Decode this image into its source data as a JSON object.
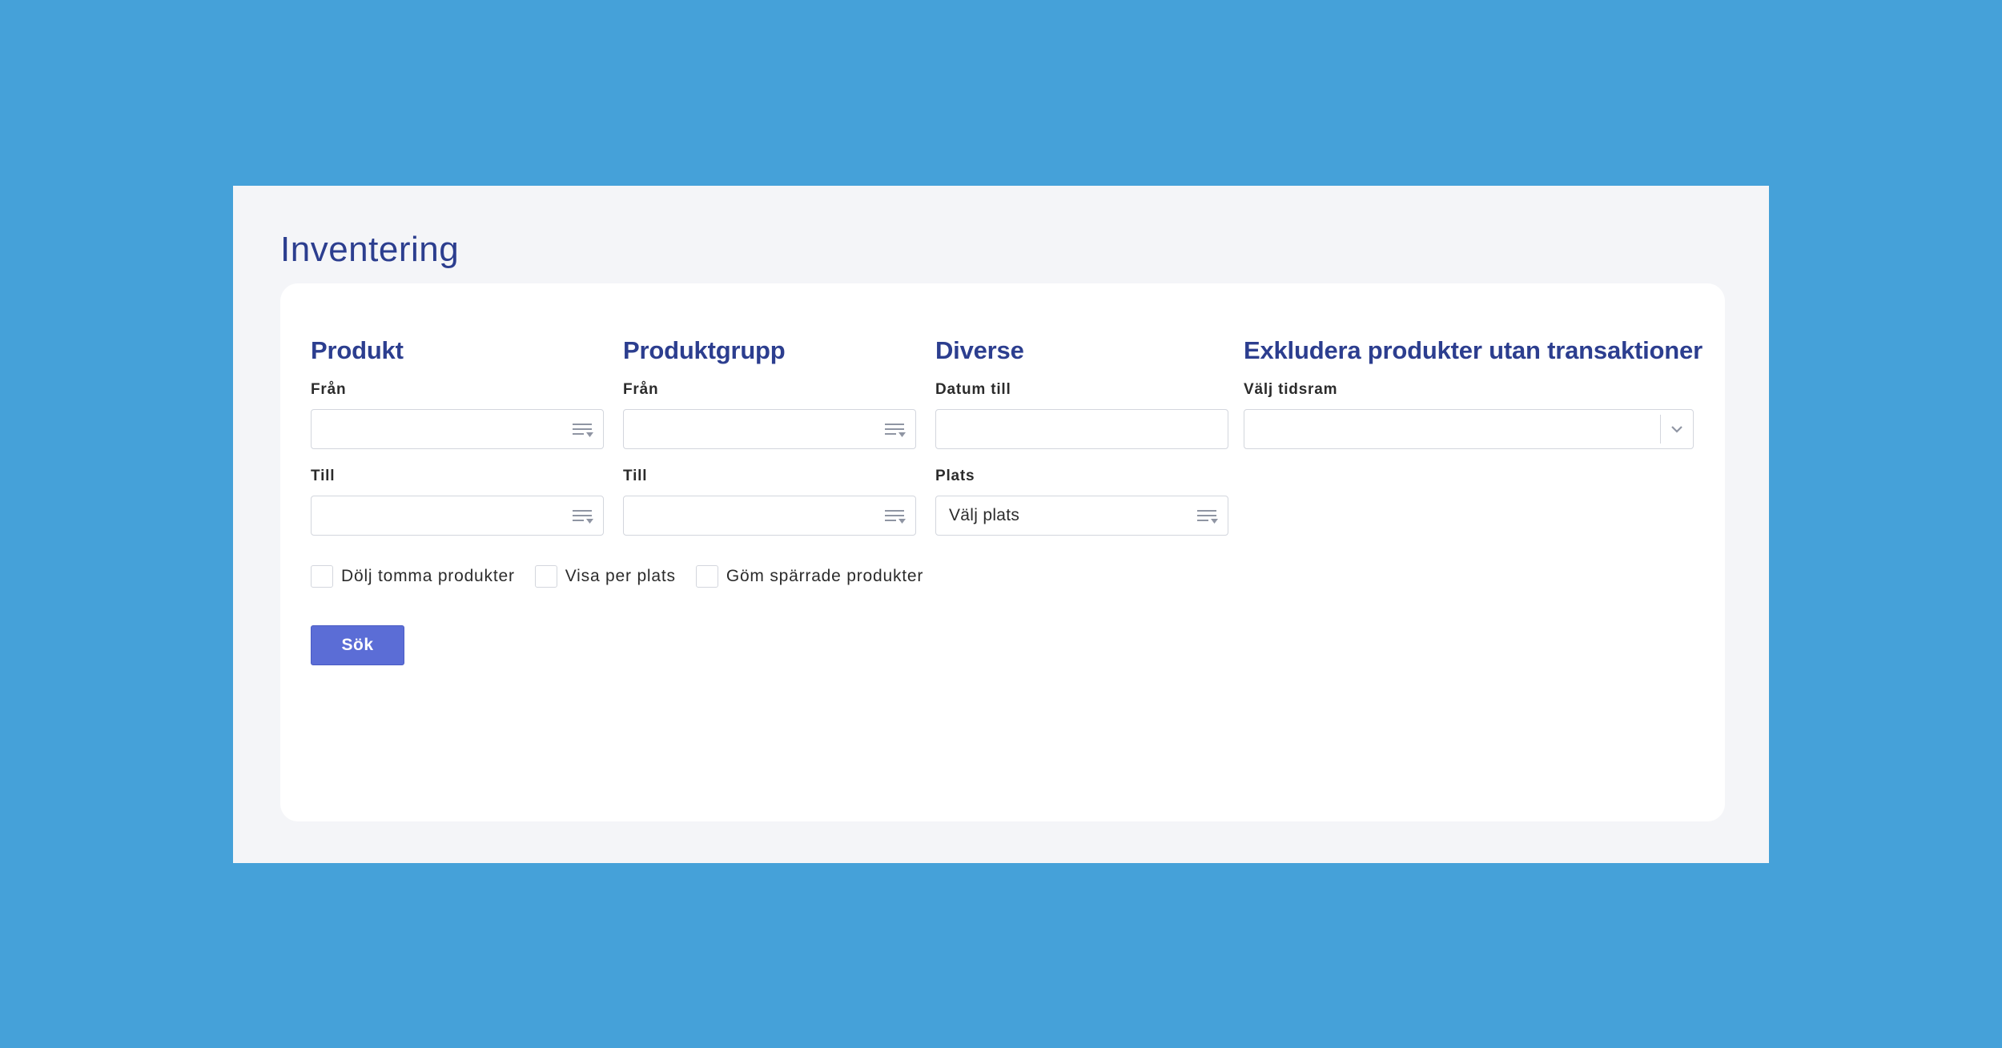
{
  "page": {
    "title": "Inventering"
  },
  "sections": {
    "produkt": {
      "title": "Produkt",
      "from_label": "Från",
      "from_value": "",
      "to_label": "Till",
      "to_value": ""
    },
    "produktgrupp": {
      "title": "Produktgrupp",
      "from_label": "Från",
      "from_value": "",
      "to_label": "Till",
      "to_value": ""
    },
    "diverse": {
      "title": "Diverse",
      "date_label": "Datum till",
      "date_value": "",
      "location_label": "Plats",
      "location_value": "Välj plats"
    },
    "exkludera": {
      "title": "Exkludera produkter utan transaktioner",
      "timeframe_label": "Välj tidsram",
      "timeframe_value": ""
    }
  },
  "checkboxes": [
    {
      "label": "Dölj tomma produkter",
      "checked": false
    },
    {
      "label": "Visa per plats",
      "checked": false
    },
    {
      "label": "Göm spärrade produkter",
      "checked": false
    }
  ],
  "search_button": {
    "label": "Sök"
  },
  "colors": {
    "background": "#45a1d9",
    "frame": "#f4f5f8",
    "heading": "#2c3e8f",
    "button": "#5b6dd6"
  },
  "icons": {
    "list_picker": "list-filter-icon",
    "select_arrow": "chevron-down-icon"
  }
}
